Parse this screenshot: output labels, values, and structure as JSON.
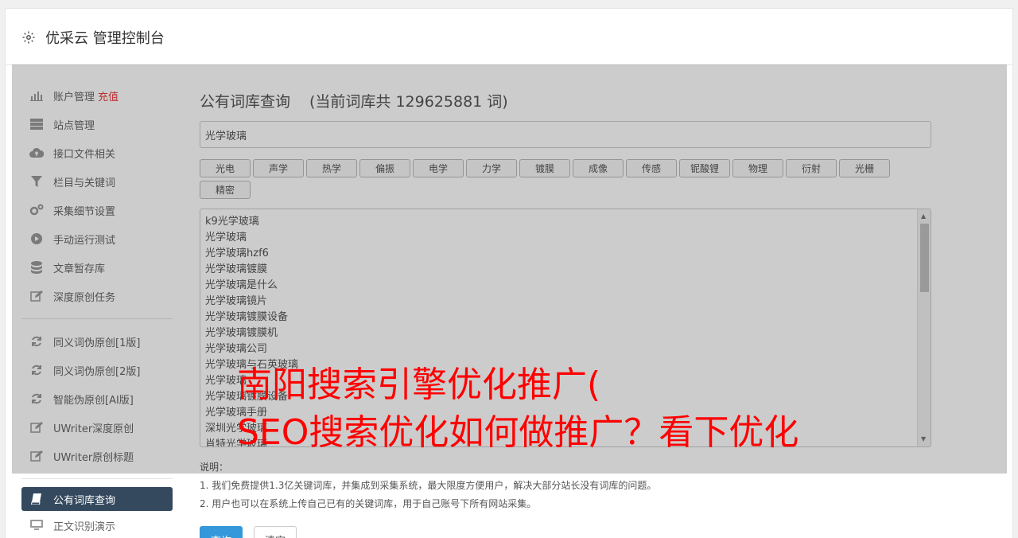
{
  "header": {
    "title": "优采云 管理控制台"
  },
  "sidebar": {
    "items": [
      {
        "label": "账户管理",
        "badge": "充值",
        "icon": "bar-chart-icon"
      },
      {
        "label": "站点管理",
        "icon": "server-icon"
      },
      {
        "label": "接口文件相关",
        "icon": "cloud-upload-icon"
      },
      {
        "label": "栏目与关键词",
        "icon": "filter-icon"
      },
      {
        "label": "采集细节设置",
        "icon": "cogs-icon"
      },
      {
        "label": "手动运行测试",
        "icon": "play-icon"
      },
      {
        "label": "文章暂存库",
        "icon": "database-icon"
      },
      {
        "label": "深度原创任务",
        "icon": "edit-icon"
      }
    ],
    "items2": [
      {
        "label": "同义词伪原创[1版]",
        "icon": "refresh-icon"
      },
      {
        "label": "同义词伪原创[2版]",
        "icon": "refresh-icon"
      },
      {
        "label": "智能伪原创[AI版]",
        "icon": "refresh-icon"
      },
      {
        "label": "UWriter深度原创",
        "icon": "edit-icon"
      },
      {
        "label": "UWriter原创标题",
        "icon": "edit-icon"
      }
    ],
    "items3": [
      {
        "label": "公有词库查询",
        "icon": "book-icon",
        "active": true
      },
      {
        "label": "正文识别演示",
        "icon": "monitor-icon"
      }
    ]
  },
  "main": {
    "title": "公有词库查询",
    "count": "(当前词库共 129625881 词)",
    "search_value": "光学玻璃",
    "tags": [
      "光电",
      "声学",
      "热学",
      "偏振",
      "电学",
      "力学",
      "镀膜",
      "成像",
      "传感",
      "铌酸锂",
      "物理",
      "衍射",
      "光栅",
      "精密"
    ],
    "results": [
      "k9光学玻璃",
      "光学玻璃",
      "光学玻璃hzf6",
      "光学玻璃镀膜",
      "光学玻璃是什么",
      "光学玻璃镜片",
      "光学玻璃镀膜设备",
      "光学玻璃镀膜机",
      "光学玻璃公司",
      "光学玻璃与石英玻璃",
      "光学玻璃",
      "光学玻璃镀膜设备",
      "光学玻璃手册",
      "深圳光学玻璃",
      "肖特光学玻璃"
    ],
    "notes_title": "说明：",
    "notes": [
      "1. 我们免费提供1.3亿关键词库，并集成到采集系统，最大限度方便用户，解决大部分站长没有词库的问题。",
      "2. 用户也可以在系统上传自己已有的关键词库，用于自己账号下所有网站采集。"
    ],
    "query_label": "查询",
    "clear_label": "清空"
  },
  "overlay_text": {
    "line1": "南阳搜索引擎优化推广(",
    "line2": "SEO搜索优化如何做推广？看下优化"
  },
  "colors": {
    "accent": "#3498db",
    "active_nav": "#34495e",
    "overlay_text": "#ff0000",
    "recharge": "#e63b3b"
  }
}
